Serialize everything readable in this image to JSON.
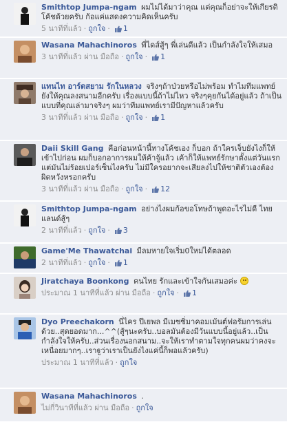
{
  "comments": [
    {
      "author": "Smithtop Jumpa-ngam",
      "text": "ผมไม่ได้มาว่าคุณ แต่คุณก็อย่าจะให้เกียรติโค้ชด้วยครับ ก้อแค่แสดงความคิดเห็นครับ",
      "time": "5 นาทีที่แล้ว",
      "via": "",
      "like_label": "ถูกใจ",
      "likes": "1"
    },
    {
      "author": "Wasana Mahachinoros",
      "text": "พี่ไดส์สู้ๆ พี่เล่นดีแล้ว เป็นกำลังใจให้เสมอ",
      "time": "3 นาทีที่แล้ว",
      "via": "ผ่าน มือถือ",
      "like_label": "ถูกใจ",
      "likes": "1"
    },
    {
      "author": "แทนไท อาร์ตสยาม รักในหลวง",
      "text": "จริงๆถ้าป่วยหรือไม่พร้อม ทำไมทีมแพทย์ยังให้คุณลงสนามอีกครับ เรื่องแบบนี้ถ้าไม่ไหว จริงๆคุยกันได้อยู่แล้ว ถ้าเป็นแบบที่คุณเล่ามาจริงๆ ผมว่าทีมแพทย์เรามีปัญหาแล้วครับ",
      "time": "3 นาทีที่แล้ว",
      "via": "ผ่าน มือถือ",
      "like_label": "ถูกใจ",
      "likes": "1"
    },
    {
      "author": "Daii Skill Gang",
      "text": "คือก่อนหน้านี้ทางโค้ชเอง ก็บอก ถ้าใครเจ็บยังไงก็ให้เข้าไปก่อน ผมก็บอกอาการผมให้ค้าจู้แล้ว เค้าก็ให้แพทย์รักษาตั้งแต่วันแรก แต่มันไม่ร้อยเปอร์เซ็นไงครับ ไม่มีใครอยากจะเสียลงไปให้ชาติตัวเองต้องผิดหวังหรอกครับ",
      "time": "3 นาทีที่แล้ว",
      "via": "ผ่าน มือถือ",
      "like_label": "ถูกใจ",
      "likes": "12"
    },
    {
      "author": "Smithtop Jumpa-ngam",
      "text": "อย่างไงผมก้อขอโทษถ้าพูดอะไรไม่ดี ไทยแลนด์สู้ๆ",
      "time": "2 นาทีที่แล้ว",
      "via": "",
      "like_label": "ถูกใจ",
      "likes": "3"
    },
    {
      "author": "Game'Me Thawatchai",
      "text": "มีลมหายใจเริ่ม0ใหม่ได้ตลอด",
      "time": "2 นาทีที่แล้ว",
      "via": "",
      "like_label": "ถูกใจ",
      "likes": "1"
    },
    {
      "author": "Jiratchaya Boonkong",
      "text": "คนไทย รักและเข้าใจกันเสมอค่ะ",
      "time": "ประมาณ 1 นาทีที่แล้ว",
      "via": "ผ่าน มือถือ",
      "like_label": "ถูกใจ",
      "likes": "1"
    },
    {
      "author": "Dyo Preechakorn",
      "text": "นี่ไคร ปีเยพล มีเมซซิ่มาคอมเม้นต์ฟอรัมการเล่นด้วย..สุดยอดมาก...^^(สู้ๆนะครับ..บอลมันต้องมีวันแบบนี้อยู่แล้ว..เป็นกำลังใจให้ครับ..ส่วนเรื่องนอกสนาม..จะให้เราทำตามใจทุกคนผมว่าคงจะเหนื่อยมากๆ..เราฐูว่าเราเป็นยังไงแค่นี้ก็พอแล้วครับ)",
      "time": "ประมาณ 1 นาทีที่แล้ว",
      "via": "",
      "like_label": "ถูกใจ",
      "likes": ""
    },
    {
      "author": "Wasana Mahachinoros",
      "text": ".",
      "time": "ไม่กี่วินาทีที่แล้ว",
      "via": "ผ่าน มือถือ",
      "like_label": "ถูกใจ",
      "likes": ""
    }
  ],
  "icons": {
    "like": "thumbs-up-icon",
    "smile": "smiley-emoji-icon"
  },
  "colors": {
    "link": "#3b5998",
    "meta": "#8c8c8c",
    "row_bg": "#edeff4"
  }
}
